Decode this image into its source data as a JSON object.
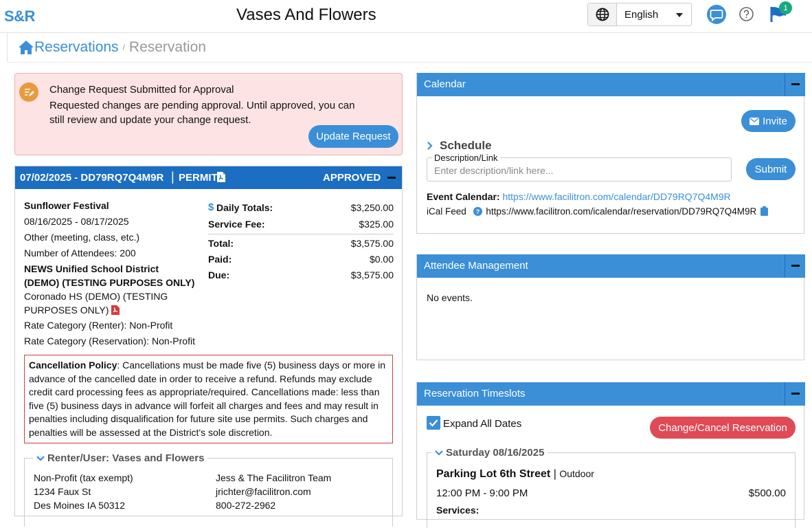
{
  "brand": {
    "logo": "S&R",
    "title": "Vases And Flowers"
  },
  "header": {
    "language": "English",
    "flag_count": "1"
  },
  "breadcrumb": {
    "root": "Reservations",
    "separator": "/",
    "current": "Reservation"
  },
  "alert": {
    "title": "Change Request Submitted for Approval",
    "message": "Requested changes are pending approval. Until approved, you can still review and update your change request.",
    "button": "Update Request"
  },
  "permit": {
    "code": "07/02/2025 - DD79RQ7Q4M9R",
    "divider": "|",
    "label": "PERMIT",
    "status": "APPROVED",
    "event_name": "Sunflower Festival",
    "dates": "08/16/2025 - 08/17/2025",
    "event_type": "Other (meeting, class, etc.)",
    "attendees": "Number of Attendees: 200",
    "district": "NEWS Unified School District (DEMO) (TESTING PURPOSES ONLY)",
    "facility": "Coronado HS (DEMO) (TESTING PURPOSES ONLY)",
    "rate_renter": "Rate Category (Renter): Non-Profit",
    "rate_reservation": "Rate Category (Reservation): Non-Profit",
    "totals": [
      {
        "label": "Daily Totals:",
        "value": "$3,250.00"
      },
      {
        "label": "Service Fee:",
        "value": "$325.00"
      },
      {
        "label": "Total:",
        "value": "$3,575.00"
      },
      {
        "label": "Paid:",
        "value": "$0.00"
      },
      {
        "label": "Due:",
        "value": "$3,575.00"
      }
    ],
    "policy_label": "Cancellation Policy",
    "policy_text": ": Cancellations must be made five (5) business days or more in advance of the cancelled date in order to receive a refund. Refunds may exclude credit card processing fees as appropriate/required. Cancellations made: less than five (5) business days in advance will forfeit all charges and fees and may result in penalties including disqualification for future site use permits. Such charges and penalties will be assessed at the District's sole discretion.",
    "renter": {
      "legend": "Renter/User: Vases and Flowers",
      "left": [
        "Non-Profit (tax exempt)",
        "1234 Faux St",
        "Des Moines IA 50312"
      ],
      "right": [
        "Jess & The Facilitron Team",
        "jrichter@facilitron.com",
        "800-272-2962"
      ]
    }
  },
  "calendar": {
    "title": "Calendar",
    "invite": "Invite",
    "schedule": "Schedule",
    "desc_label": "Description/Link",
    "desc_placeholder": "Enter description/link here...",
    "submit": "Submit",
    "event_calendar_label": "Event Calendar:",
    "event_calendar_url": "https://www.facilitron.com/calendar/DD79RQ7Q4M9R",
    "ical_label": "iCal Feed",
    "ical_url": "https://www.facilitron.com/icalendar/reservation/DD79RQ7Q4M9R"
  },
  "attendee": {
    "title": "Attendee Management",
    "empty": "No events."
  },
  "timeslots": {
    "title": "Reservation Timeslots",
    "expand_label": "Expand All Dates",
    "change_button": "Change/Cancel Reservation",
    "day": "Saturday 08/16/2025",
    "location": "Parking Lot 6th Street",
    "location_sep": "|",
    "location_type": "Outdoor",
    "time": "12:00 PM - 9:00 PM",
    "price": "$500.00",
    "services_label": "Services:"
  },
  "colors": {
    "primary": "#3a8fd6",
    "header_dark": "#1b6ec2",
    "alert_bg": "#fde3e3",
    "danger": "#e04a55",
    "badge": "#19a97d"
  }
}
